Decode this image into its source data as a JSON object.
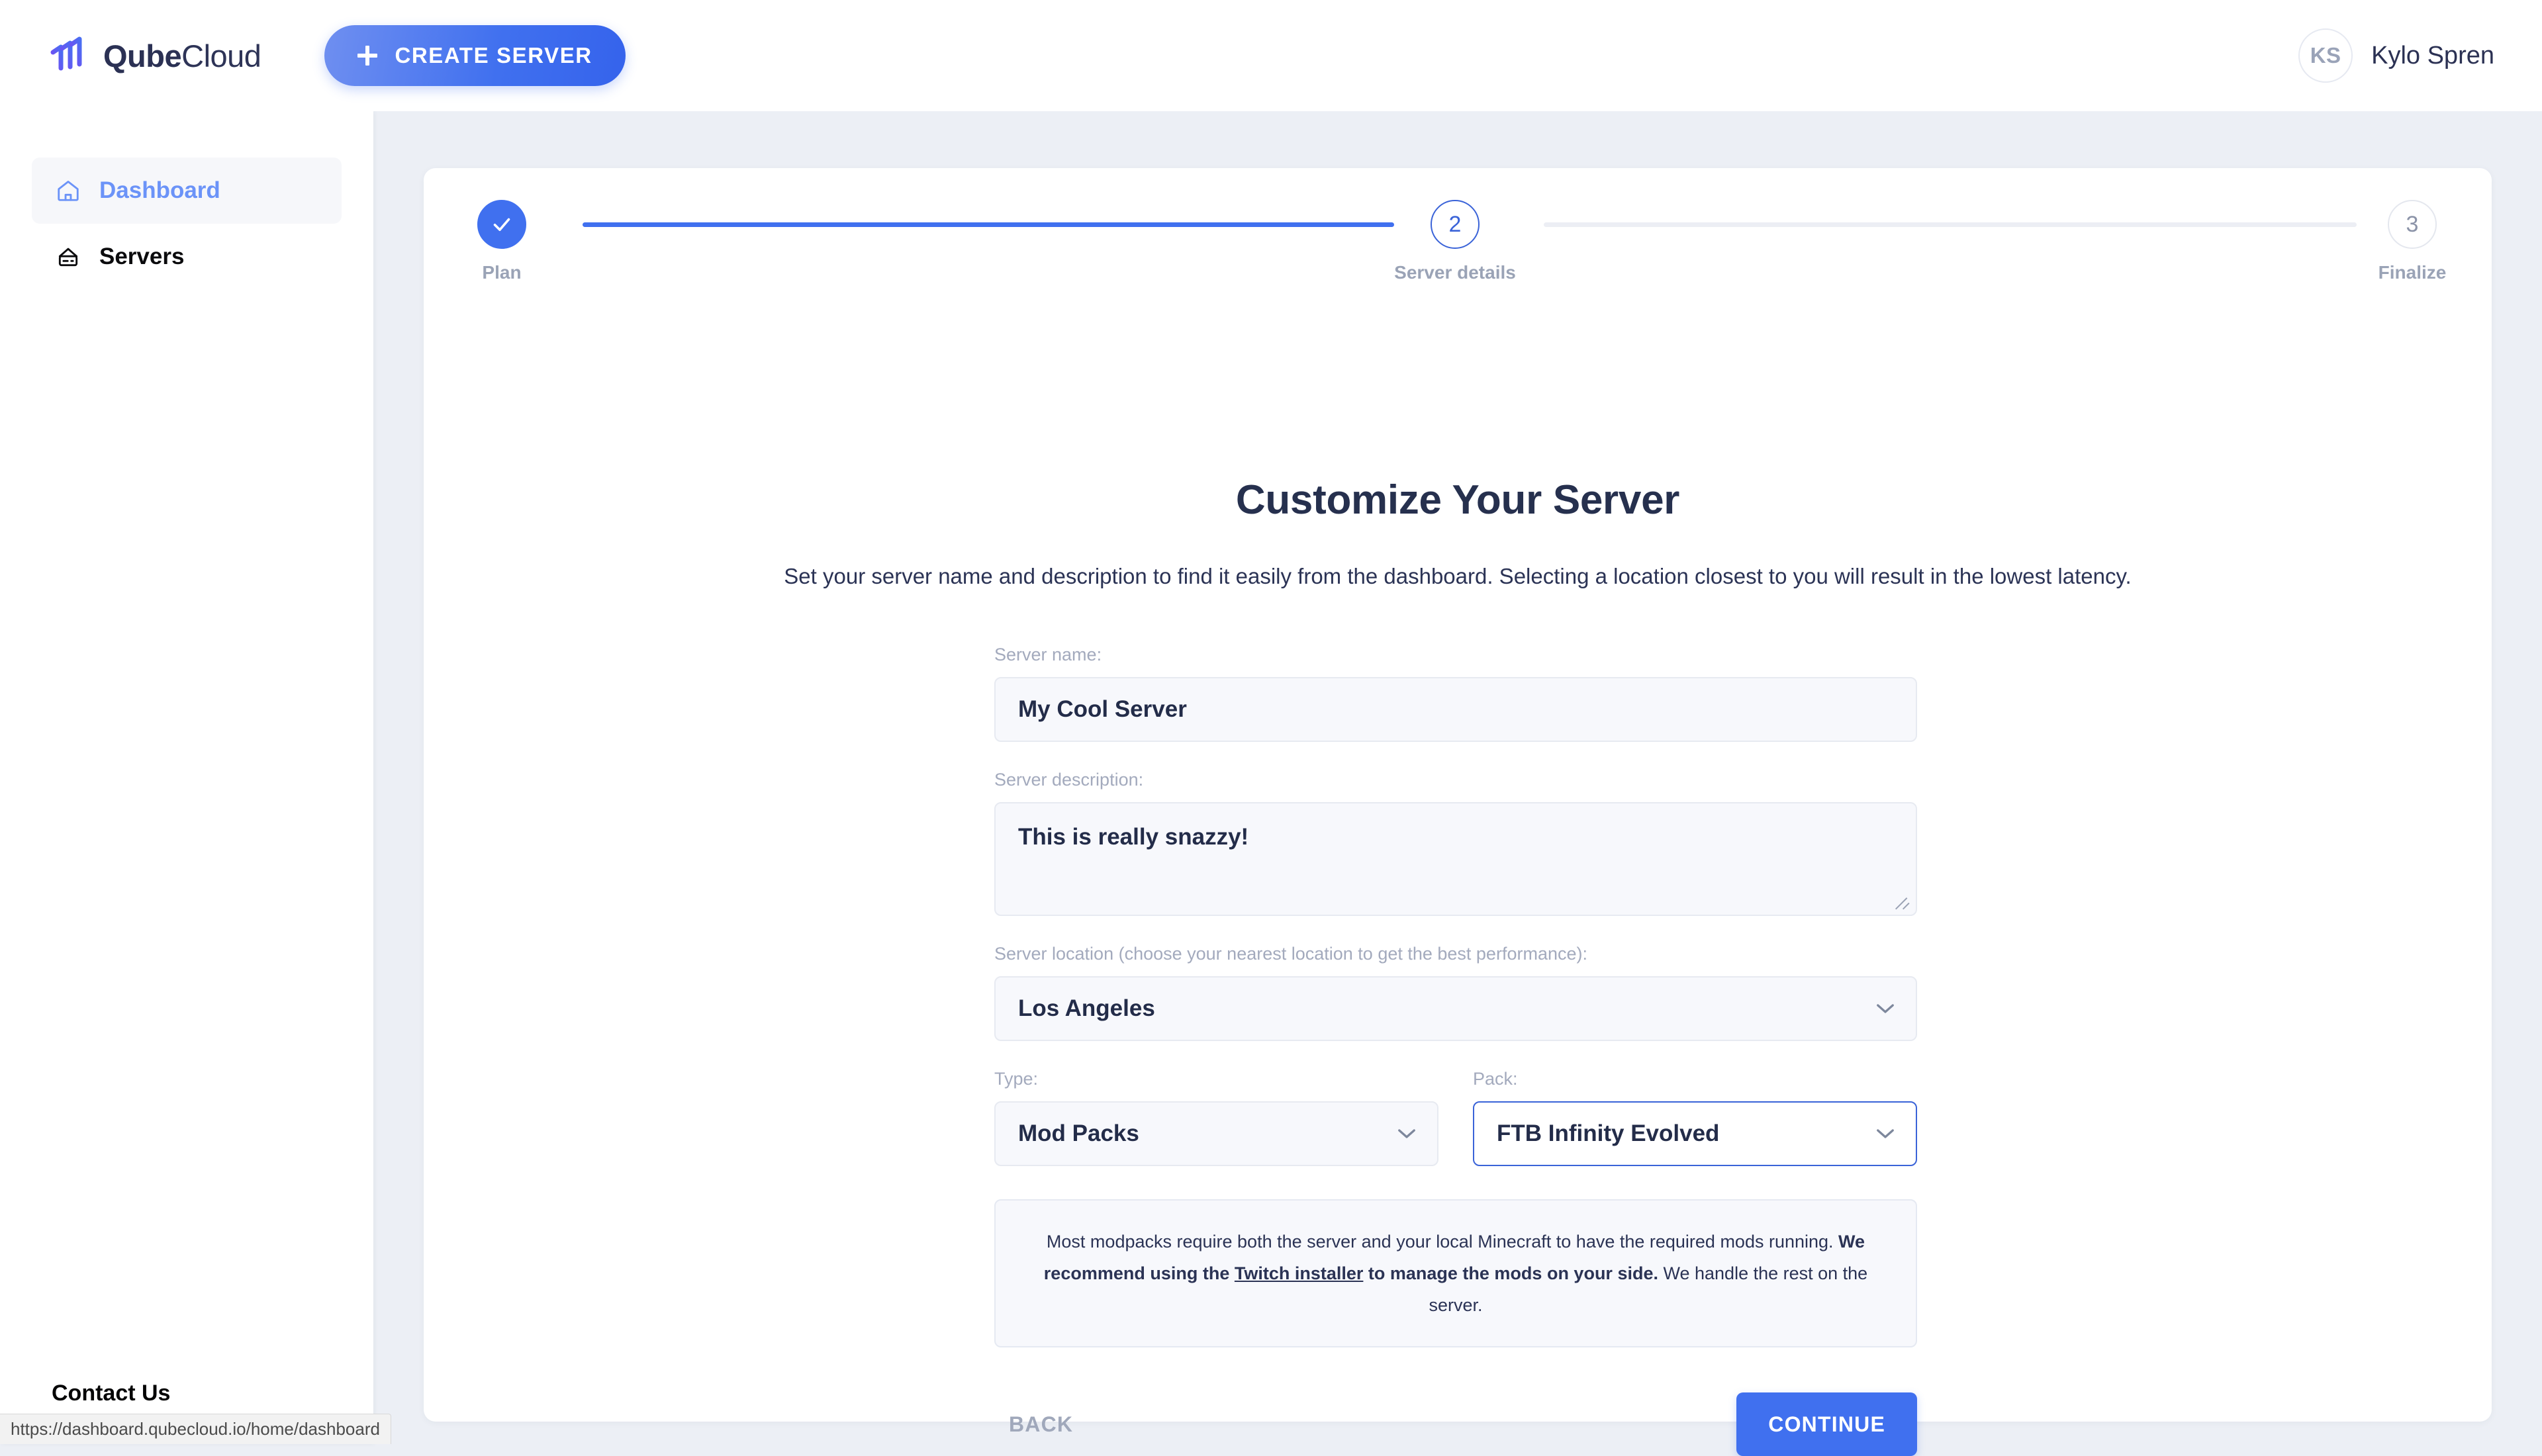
{
  "brand": {
    "name_bold": "Qube",
    "name_light": "Cloud",
    "logo_icon": "qubecloud-logo-icon"
  },
  "topbar": {
    "create_server_label": "CREATE SERVER",
    "plus_icon": "plus-icon",
    "user": {
      "initials": "KS",
      "name": "Kylo Spren"
    }
  },
  "sidebar": {
    "items": [
      {
        "label": "Dashboard",
        "icon": "home-icon",
        "active": true
      },
      {
        "label": "Servers",
        "icon": "server-icon",
        "active": false
      }
    ],
    "contact_us_label": "Contact Us"
  },
  "stepper": {
    "steps": [
      {
        "number": "1",
        "label": "Plan",
        "state": "done",
        "mark": "check-icon"
      },
      {
        "number": "2",
        "label": "Server details",
        "state": "current"
      },
      {
        "number": "3",
        "label": "Finalize",
        "state": "todo"
      }
    ]
  },
  "main": {
    "title": "Customize Your Server",
    "subtitle": "Set your server name and description to find it easily from the dashboard. Selecting a location closest to you will result in the lowest latency."
  },
  "form": {
    "server_name": {
      "label": "Server name:",
      "value": "My Cool Server",
      "placeholder": "Server name"
    },
    "server_description": {
      "label": "Server description:",
      "value": "This is really snazzy!",
      "placeholder": "Server description"
    },
    "server_location": {
      "label": "Server location (choose your nearest location to get the best performance):",
      "value": "Los Angeles"
    },
    "type": {
      "label": "Type:",
      "value": "Mod Packs"
    },
    "pack": {
      "label": "Pack:",
      "value": "FTB Infinity Evolved"
    },
    "info": {
      "part1": "Most modpacks require both the server and your local Minecraft to have the required mods running. ",
      "bold1": "We recommend using the ",
      "link": "Twitch installer",
      "bold2": " to manage the mods on your side.",
      "part2": " We handle the rest on the server."
    },
    "back_label": "BACK",
    "continue_label": "CONTINUE"
  },
  "status_bar": {
    "url": "https://dashboard.qubecloud.io/home/dashboard"
  },
  "colors": {
    "accent_blue": "#4070ef",
    "accent_blue_light": "#6b93f8",
    "logo_purple": "#6f4df0",
    "text_navy": "#2b3355",
    "muted_gray": "#a3aabd",
    "page_bg": "#eceff5"
  }
}
